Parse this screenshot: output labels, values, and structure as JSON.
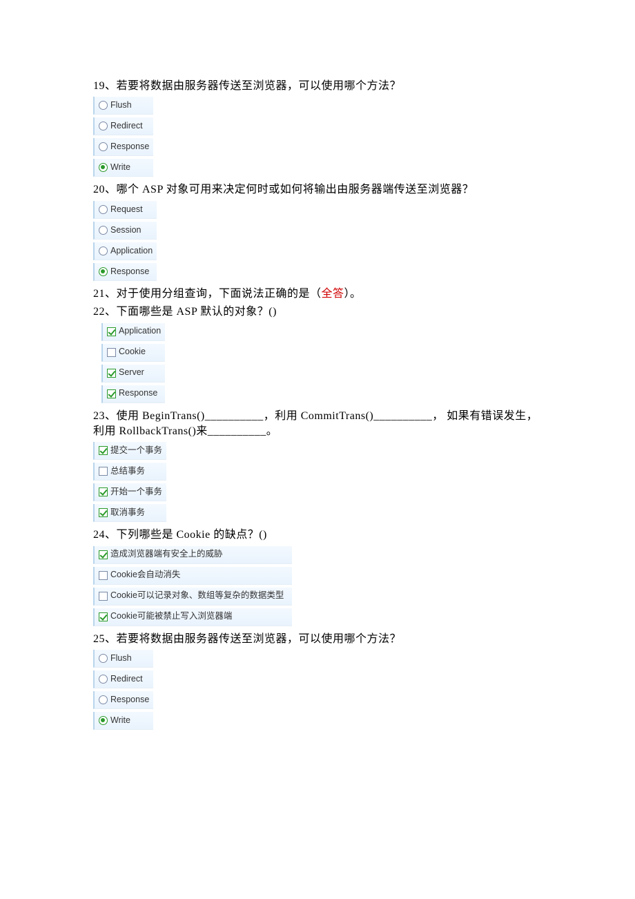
{
  "questions": [
    {
      "number": "19",
      "text": "、若要将数据由服务器传送至浏览器，可以使用哪个方法？",
      "type": "radio",
      "options": [
        {
          "label": "Flush",
          "selected": false
        },
        {
          "label": "Redirect",
          "selected": false
        },
        {
          "label": "Response",
          "selected": false
        },
        {
          "label": "Write",
          "selected": true
        }
      ]
    },
    {
      "number": "20",
      "text": "、哪个 ASP 对象可用来决定何时或如何将输出由服务器端传送至浏览器？",
      "type": "radio",
      "options": [
        {
          "label": "Request",
          "selected": false
        },
        {
          "label": "Session",
          "selected": false
        },
        {
          "label": "Application",
          "selected": false
        },
        {
          "label": "Response",
          "selected": true
        }
      ]
    },
    {
      "number": "21",
      "text_pre": "、对于使用分组查询，下面说法正确的是（",
      "text_red": "全答",
      "text_post": "）。",
      "type": "text_only"
    },
    {
      "number": "22",
      "text": "、下面哪些是 ASP 默认的对象？()",
      "type": "checkbox",
      "indent": true,
      "options": [
        {
          "label": "Application",
          "selected": true
        },
        {
          "label": "Cookie",
          "selected": false
        },
        {
          "label": "Server",
          "selected": true
        },
        {
          "label": "Response",
          "selected": true
        }
      ]
    },
    {
      "number": "23",
      "text": "、使用 BeginTrans()__________，利用 CommitTrans()__________， 如果有错误发生，利用 RollbackTrans()来__________。",
      "type": "checkbox",
      "options": [
        {
          "label": "提交一个事务",
          "selected": true
        },
        {
          "label": "总结事务",
          "selected": false
        },
        {
          "label": "开始一个事务",
          "selected": true
        },
        {
          "label": "取消事务",
          "selected": true
        }
      ]
    },
    {
      "number": "24",
      "text": "、下列哪些是 Cookie 的缺点？()",
      "type": "checkbox",
      "wide": true,
      "options": [
        {
          "label": "造成浏览器端有安全上的威胁",
          "selected": true
        },
        {
          "label": "Cookie会自动消失",
          "selected": false
        },
        {
          "label": "Cookie可以记录对象、数组等复杂的数据类型",
          "selected": false
        },
        {
          "label": "Cookie可能被禁止写入浏览器端",
          "selected": true
        }
      ]
    },
    {
      "number": "25",
      "text": "、若要将数据由服务器传送至浏览器，可以使用哪个方法？",
      "type": "radio",
      "options": [
        {
          "label": "Flush",
          "selected": false
        },
        {
          "label": "Redirect",
          "selected": false
        },
        {
          "label": "Response",
          "selected": false
        },
        {
          "label": "Write",
          "selected": true
        }
      ]
    }
  ]
}
